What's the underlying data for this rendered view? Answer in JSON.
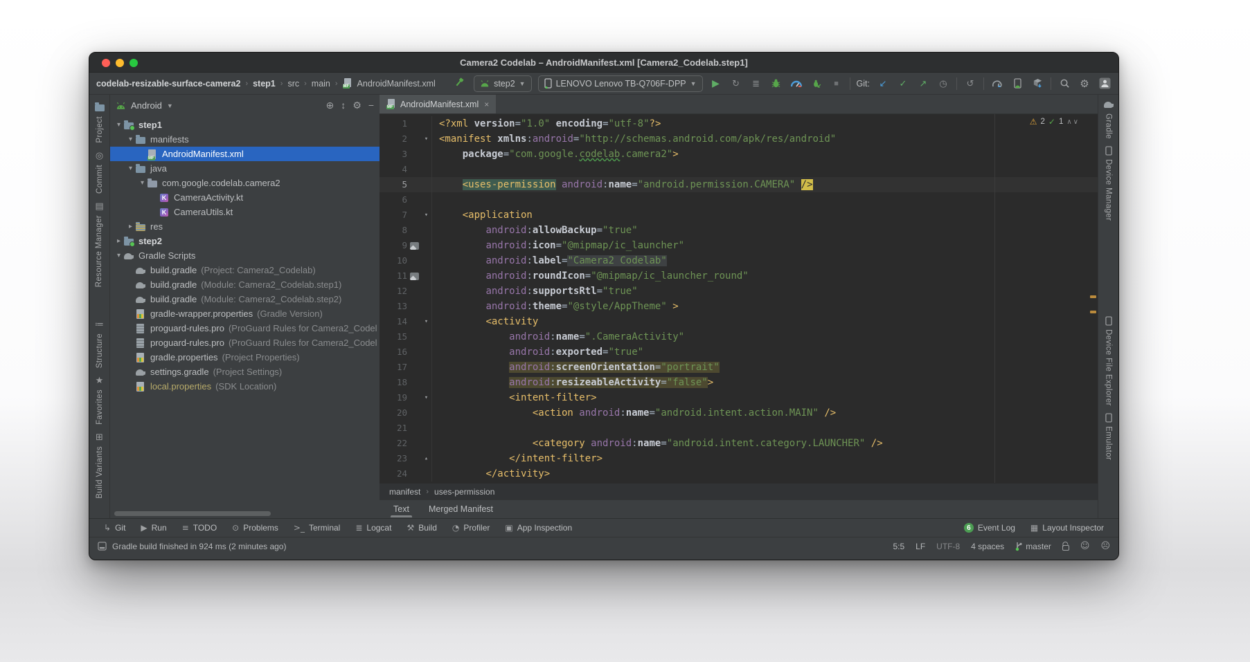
{
  "window": {
    "title": "Camera2 Codelab – AndroidManifest.xml [Camera2_Codelab.step1]"
  },
  "colors": {
    "selection_blue": "#2965c0",
    "run_green": "#5fad65",
    "warn_yellow": "#e2a53a",
    "error_stripe_orange": "#ba8a3c",
    "editor_bg": "#2b2b2b",
    "panel_bg": "#3c3f41"
  },
  "navbar": {
    "breadcrumbs": [
      "codelab-resizable-surface-camera2",
      "step1",
      "src",
      "main",
      "AndroidManifest.xml"
    ],
    "run_config": "step2",
    "device": "LENOVO Lenovo TB-Q706F-DPP",
    "git_label": "Git:"
  },
  "left_strip": {
    "items": [
      {
        "label": "Project"
      },
      {
        "label": "Commit"
      },
      {
        "label": "Resource Manager"
      },
      {
        "label": "Structure"
      },
      {
        "label": "Favorites"
      },
      {
        "label": "Build Variants"
      }
    ]
  },
  "right_strip": {
    "items": [
      {
        "label": "Gradle"
      },
      {
        "label": "Device Manager"
      },
      {
        "label": "Device File Explorer"
      },
      {
        "label": "Emulator"
      }
    ]
  },
  "project": {
    "header": {
      "mode": "Android"
    },
    "tree": [
      {
        "d": 0,
        "chev": "open",
        "icon": "folder-module",
        "label": "step1",
        "bold": true
      },
      {
        "d": 1,
        "chev": "open",
        "icon": "folder",
        "label": "manifests"
      },
      {
        "d": 2,
        "chev": "none",
        "icon": "manifest-file",
        "label": "AndroidManifest.xml",
        "selected": true
      },
      {
        "d": 1,
        "chev": "open",
        "icon": "folder",
        "label": "java"
      },
      {
        "d": 2,
        "chev": "open",
        "icon": "package",
        "label": "com.google.codelab.camera2"
      },
      {
        "d": 3,
        "chev": "none",
        "icon": "kotlin-file",
        "label": "CameraActivity.kt"
      },
      {
        "d": 3,
        "chev": "none",
        "icon": "kotlin-file",
        "label": "CameraUtils.kt"
      },
      {
        "d": 1,
        "chev": "closed",
        "icon": "folder-res",
        "label": "res"
      },
      {
        "d": 0,
        "chev": "closed",
        "icon": "folder-module",
        "label": "step2",
        "bold": true
      },
      {
        "d": 0,
        "chev": "open",
        "icon": "gradle",
        "label": "Gradle Scripts"
      },
      {
        "d": 1,
        "chev": "none",
        "icon": "gradle",
        "label": "build.gradle",
        "ann": "(Project: Camera2_Codelab)"
      },
      {
        "d": 1,
        "chev": "none",
        "icon": "gradle",
        "label": "build.gradle",
        "ann": "(Module: Camera2_Codelab.step1)"
      },
      {
        "d": 1,
        "chev": "none",
        "icon": "gradle",
        "label": "build.gradle",
        "ann": "(Module: Camera2_Codelab.step2)"
      },
      {
        "d": 1,
        "chev": "none",
        "icon": "properties-file",
        "label": "gradle-wrapper.properties",
        "ann": "(Gradle Version)"
      },
      {
        "d": 1,
        "chev": "none",
        "icon": "text-file",
        "label": "proguard-rules.pro",
        "ann": "(ProGuard Rules for Camera2_Codel"
      },
      {
        "d": 1,
        "chev": "none",
        "icon": "text-file",
        "label": "proguard-rules.pro",
        "ann": "(ProGuard Rules for Camera2_Codel"
      },
      {
        "d": 1,
        "chev": "none",
        "icon": "properties-file",
        "label": "gradle.properties",
        "ann": "(Project Properties)"
      },
      {
        "d": 1,
        "chev": "none",
        "icon": "gradle",
        "label": "settings.gradle",
        "ann": "(Project Settings)"
      },
      {
        "d": 1,
        "chev": "none",
        "icon": "properties-file",
        "label": "local.properties",
        "ann": "(SDK Location)",
        "muted": true
      }
    ]
  },
  "editor": {
    "tab": "AndroidManifest.xml",
    "inspections": {
      "warnings": "2",
      "oks": "1"
    },
    "breadcrumbs": [
      "manifest",
      "uses-permission"
    ],
    "bottom_tabs": [
      "Text",
      "Merged Manifest"
    ],
    "lines": [
      {
        "n": 1,
        "g": "",
        "t": [
          [
            "tag",
            "<?xml "
          ],
          [
            "attr",
            "version"
          ],
          [
            "pl",
            "="
          ],
          [
            "val",
            "\"1.0\""
          ],
          [
            "pl",
            " "
          ],
          [
            "attr",
            "encoding"
          ],
          [
            "pl",
            "="
          ],
          [
            "val",
            "\"utf-8\""
          ],
          [
            "tag",
            "?>"
          ]
        ]
      },
      {
        "n": 2,
        "g": "fold",
        "t": [
          [
            "tag",
            "<manifest "
          ],
          [
            "attr",
            "xmlns"
          ],
          [
            "pl",
            ":"
          ],
          [
            "ns",
            "android"
          ],
          [
            "pl",
            "="
          ],
          [
            "val",
            "\"http://schemas.android.com/apk/res/android\""
          ]
        ]
      },
      {
        "n": 3,
        "g": "",
        "t": [
          [
            "pl",
            "    "
          ],
          [
            "attr",
            "package"
          ],
          [
            "pl",
            "="
          ],
          [
            "val",
            "\"com.google."
          ],
          [
            "typo",
            "codelab"
          ],
          [
            "val",
            ".camera2\""
          ],
          [
            "tag",
            ">"
          ]
        ]
      },
      {
        "n": 4,
        "g": "",
        "t": []
      },
      {
        "n": 5,
        "g": "",
        "cur": true,
        "t": [
          [
            "pl",
            "    "
          ],
          [
            "tag",
            "<uses-permission",
            "sel"
          ],
          [
            "pl",
            " "
          ],
          [
            "ns",
            "android"
          ],
          [
            "pl",
            ":"
          ],
          [
            "attr",
            "name"
          ],
          [
            "pl",
            "="
          ],
          [
            "val",
            "\"android.permission.CAMERA\""
          ],
          [
            "pl",
            " "
          ],
          [
            "warn",
            "/>"
          ]
        ]
      },
      {
        "n": 6,
        "g": "",
        "t": []
      },
      {
        "n": 7,
        "g": "fold",
        "t": [
          [
            "pl",
            "    "
          ],
          [
            "tag",
            "<application"
          ]
        ]
      },
      {
        "n": 8,
        "g": "",
        "t": [
          [
            "pl",
            "        "
          ],
          [
            "ns",
            "android"
          ],
          [
            "pl",
            ":"
          ],
          [
            "attr",
            "allowBackup"
          ],
          [
            "pl",
            "="
          ],
          [
            "val",
            "\"true\""
          ]
        ]
      },
      {
        "n": 9,
        "g": "img",
        "t": [
          [
            "pl",
            "        "
          ],
          [
            "ns",
            "android"
          ],
          [
            "pl",
            ":"
          ],
          [
            "attr",
            "icon"
          ],
          [
            "pl",
            "="
          ],
          [
            "val",
            "\"@mipmap/ic_launcher\""
          ]
        ]
      },
      {
        "n": 10,
        "g": "",
        "t": [
          [
            "pl",
            "        "
          ],
          [
            "ns",
            "android"
          ],
          [
            "pl",
            ":"
          ],
          [
            "attr",
            "label"
          ],
          [
            "pl",
            "="
          ],
          [
            "val",
            "\"Camera2 Codelab\"",
            "frag"
          ]
        ]
      },
      {
        "n": 11,
        "g": "img",
        "t": [
          [
            "pl",
            "        "
          ],
          [
            "ns",
            "android"
          ],
          [
            "pl",
            ":"
          ],
          [
            "attr",
            "roundIcon"
          ],
          [
            "pl",
            "="
          ],
          [
            "val",
            "\"@mipmap/ic_launcher_round\""
          ]
        ]
      },
      {
        "n": 12,
        "g": "",
        "t": [
          [
            "pl",
            "        "
          ],
          [
            "ns",
            "android"
          ],
          [
            "pl",
            ":"
          ],
          [
            "attr",
            "supportsRtl"
          ],
          [
            "pl",
            "="
          ],
          [
            "val",
            "\"true\""
          ]
        ]
      },
      {
        "n": 13,
        "g": "",
        "t": [
          [
            "pl",
            "        "
          ],
          [
            "ns",
            "android"
          ],
          [
            "pl",
            ":"
          ],
          [
            "attr",
            "theme"
          ],
          [
            "pl",
            "="
          ],
          [
            "val",
            "\"@style/AppTheme\""
          ],
          [
            "pl",
            " "
          ],
          [
            "tag",
            ">"
          ]
        ]
      },
      {
        "n": 14,
        "g": "fold",
        "t": [
          [
            "pl",
            "        "
          ],
          [
            "tag",
            "<activity"
          ]
        ]
      },
      {
        "n": 15,
        "g": "",
        "t": [
          [
            "pl",
            "            "
          ],
          [
            "ns",
            "android"
          ],
          [
            "pl",
            ":"
          ],
          [
            "attr",
            "name"
          ],
          [
            "pl",
            "="
          ],
          [
            "val",
            "\".CameraActivity\""
          ]
        ]
      },
      {
        "n": 16,
        "g": "",
        "t": [
          [
            "pl",
            "            "
          ],
          [
            "ns",
            "android"
          ],
          [
            "pl",
            ":"
          ],
          [
            "attr",
            "exported"
          ],
          [
            "pl",
            "="
          ],
          [
            "val",
            "\"true\""
          ]
        ]
      },
      {
        "n": 17,
        "g": "",
        "t": [
          [
            "pl",
            "            "
          ],
          [
            "ns",
            "android",
            "olv"
          ],
          [
            "pl",
            ":",
            "olv"
          ],
          [
            "attr",
            "screenOrientation",
            "olv"
          ],
          [
            "pl",
            "=",
            "olv"
          ],
          [
            "val",
            "\"portrait\"",
            "olv"
          ]
        ]
      },
      {
        "n": 18,
        "g": "",
        "t": [
          [
            "pl",
            "            "
          ],
          [
            "ns",
            "android",
            "olv"
          ],
          [
            "pl",
            ":",
            "olv"
          ],
          [
            "attr",
            "resizeableActivity",
            "olv"
          ],
          [
            "pl",
            "=",
            "olv"
          ],
          [
            "val",
            "\"false\"",
            "olv"
          ],
          [
            "tag",
            ">"
          ]
        ]
      },
      {
        "n": 19,
        "g": "fold",
        "t": [
          [
            "pl",
            "            "
          ],
          [
            "tag",
            "<intent-filter>"
          ]
        ]
      },
      {
        "n": 20,
        "g": "",
        "t": [
          [
            "pl",
            "                "
          ],
          [
            "tag",
            "<action "
          ],
          [
            "ns",
            "android"
          ],
          [
            "pl",
            ":"
          ],
          [
            "attr",
            "name"
          ],
          [
            "pl",
            "="
          ],
          [
            "val",
            "\"android.intent.action.MAIN\""
          ],
          [
            "pl",
            " "
          ],
          [
            "tag",
            "/>"
          ]
        ]
      },
      {
        "n": 21,
        "g": "",
        "t": []
      },
      {
        "n": 22,
        "g": "",
        "t": [
          [
            "pl",
            "                "
          ],
          [
            "tag",
            "<category "
          ],
          [
            "ns",
            "android"
          ],
          [
            "pl",
            ":"
          ],
          [
            "attr",
            "name"
          ],
          [
            "pl",
            "="
          ],
          [
            "val",
            "\"android.intent.category.LAUNCHER\""
          ],
          [
            "pl",
            " "
          ],
          [
            "tag",
            "/>"
          ]
        ]
      },
      {
        "n": 23,
        "g": "foldend",
        "t": [
          [
            "pl",
            "            "
          ],
          [
            "tag",
            "</intent-filter>"
          ]
        ]
      },
      {
        "n": 24,
        "g": "",
        "t": [
          [
            "pl",
            "        "
          ],
          [
            "tag",
            "</activity>"
          ]
        ]
      }
    ]
  },
  "toolwindow_bar": {
    "left": [
      {
        "icon": "git-branch-icon",
        "glyph": "↳",
        "label": "Git"
      },
      {
        "icon": "run-icon",
        "glyph": "▶",
        "label": "Run",
        "green": true
      },
      {
        "icon": "todo-icon",
        "glyph": "≡",
        "label": "TODO"
      },
      {
        "icon": "problems-icon",
        "glyph": "⊙",
        "label": "Problems"
      },
      {
        "icon": "terminal-icon",
        "glyph": ">_",
        "label": "Terminal"
      },
      {
        "icon": "logcat-icon",
        "glyph": "≣",
        "label": "Logcat"
      },
      {
        "icon": "build-hammer-icon",
        "glyph": "⚒",
        "label": "Build"
      },
      {
        "icon": "profiler-icon",
        "glyph": "◔",
        "label": "Profiler"
      },
      {
        "icon": "app-inspection-icon",
        "glyph": "▣",
        "label": "App Inspection"
      }
    ],
    "right": [
      {
        "icon": "event-log-icon",
        "label": "Event Log",
        "badge": "6"
      },
      {
        "icon": "layout-inspector-icon",
        "glyph": "▦",
        "label": "Layout Inspector"
      }
    ]
  },
  "status_bar": {
    "message": "Gradle build finished in 924 ms (2 minutes ago)",
    "caret": "5:5",
    "line_sep": "LF",
    "encoding": "UTF-8",
    "indent": "4 spaces",
    "branch": "master"
  }
}
